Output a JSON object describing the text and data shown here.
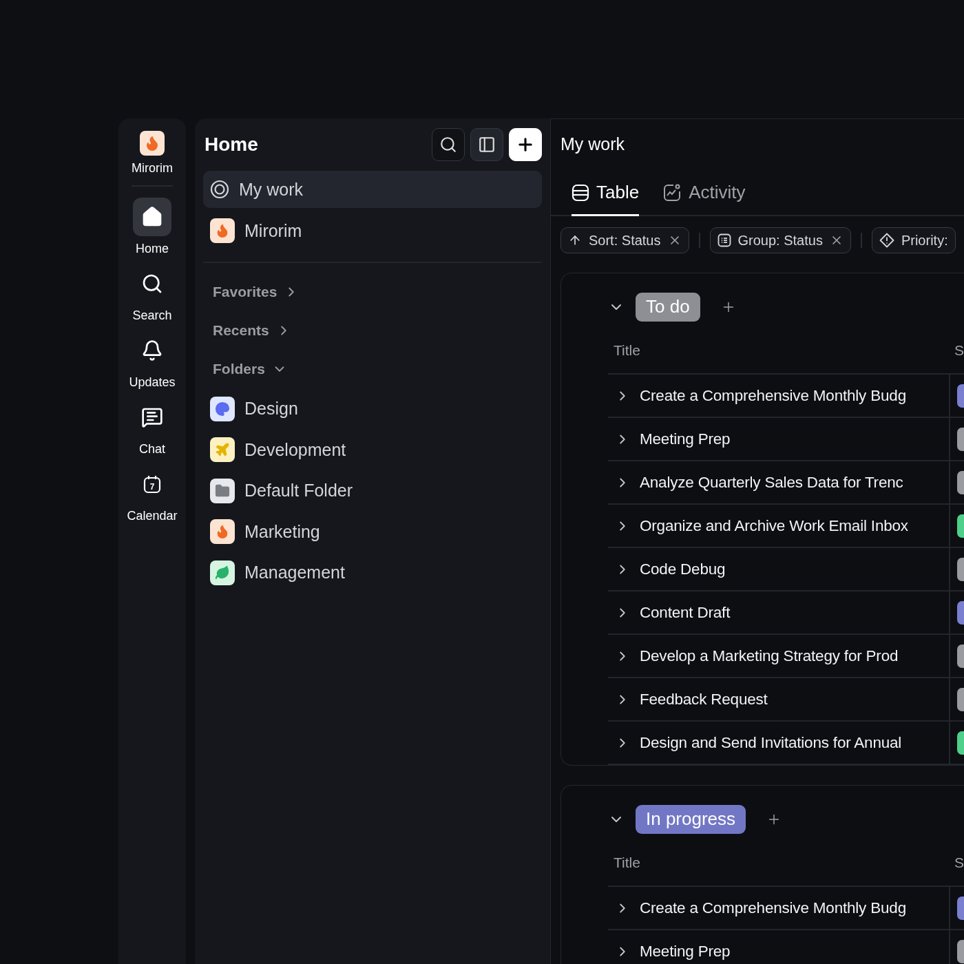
{
  "rail": {
    "brand": {
      "label": "Mirorim"
    },
    "items": [
      {
        "kind": "home",
        "label": "Home",
        "selected": true
      },
      {
        "kind": "search",
        "label": "Search",
        "selected": false
      },
      {
        "kind": "bell",
        "label": "Updates",
        "selected": false
      },
      {
        "kind": "chat",
        "label": "Chat",
        "selected": false
      },
      {
        "kind": "calendar",
        "label": "Calendar",
        "selected": false,
        "icon_text": "7"
      }
    ]
  },
  "sidebar": {
    "title": "Home",
    "nav": [
      {
        "kind": "target",
        "label": "My work",
        "selected": true
      },
      {
        "kind": "flame",
        "label": "Mirorim",
        "selected": false
      }
    ],
    "sections": [
      {
        "label": "Favorites",
        "expanded": false
      },
      {
        "label": "Recents",
        "expanded": false
      },
      {
        "label": "Folders",
        "expanded": true
      }
    ],
    "folders": [
      {
        "kind": "palette",
        "label": "Design",
        "color": "#dfe6ff"
      },
      {
        "kind": "plane",
        "label": "Development",
        "color": "#fdf1c2"
      },
      {
        "kind": "folder",
        "label": "Default Folder",
        "color": "#e6e8ee"
      },
      {
        "kind": "flame",
        "label": "Marketing",
        "color": "#fde4d2"
      },
      {
        "kind": "leaf",
        "label": "Management",
        "color": "#d6f5e1"
      }
    ]
  },
  "main": {
    "title": "My work",
    "tabs": [
      {
        "kind": "table",
        "label": "Table",
        "selected": true
      },
      {
        "kind": "activity",
        "label": "Activity",
        "selected": false
      }
    ],
    "filters": [
      {
        "kind": "sort",
        "label": "Sort: Status",
        "removable": true
      },
      {
        "kind": "group",
        "label": "Group: Status",
        "removable": true
      },
      {
        "kind": "priority",
        "label": "Priority:",
        "removable": false
      }
    ],
    "groups": [
      {
        "label": "To do",
        "color": "#8e8f94",
        "columns": [
          "Title",
          "S"
        ],
        "rows": [
          {
            "title": "Create a Comprehensive Monthly Budg",
            "color": "#7b7fd0"
          },
          {
            "title": "Meeting Prep",
            "color": "#9a9ba0"
          },
          {
            "title": "Analyze Quarterly Sales Data for Trenc",
            "color": "#9a9ba0"
          },
          {
            "title": "Organize and Archive Work Email Inbox",
            "color": "#4fd08a"
          },
          {
            "title": "Code Debug",
            "color": "#9a9ba0"
          },
          {
            "title": "Content Draft",
            "color": "#7b7fd0"
          },
          {
            "title": "Develop a Marketing Strategy for Prod",
            "color": "#9a9ba0"
          },
          {
            "title": "Feedback Request",
            "color": "#9a9ba0"
          },
          {
            "title": "Design and Send Invitations for Annual",
            "color": "#4fd08a"
          }
        ]
      },
      {
        "label": "In progress",
        "color": "#7277c5",
        "columns": [
          "Title",
          "S"
        ],
        "rows": [
          {
            "title": "Create a Comprehensive Monthly Budg",
            "color": "#7b7fd0"
          },
          {
            "title": "Meeting Prep",
            "color": "#9a9ba0"
          }
        ]
      }
    ]
  }
}
